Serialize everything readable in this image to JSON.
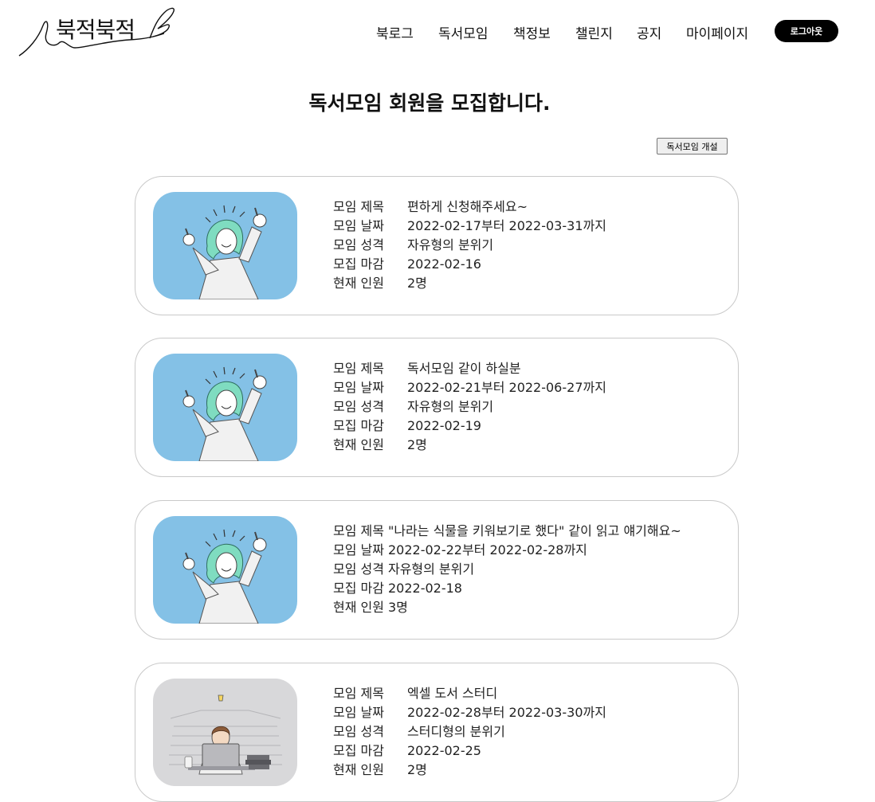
{
  "header": {
    "logo_text": "북적북적",
    "nav": [
      {
        "label": "북로그"
      },
      {
        "label": "독서모임"
      },
      {
        "label": "책정보"
      },
      {
        "label": "챌린지"
      },
      {
        "label": "공지"
      },
      {
        "label": "마이페이지"
      }
    ],
    "logout_label": "로그아웃"
  },
  "main": {
    "title": "독서모임 회원을 모집합니다.",
    "create_button_label": "독서모임 개설"
  },
  "field_labels": {
    "title": "모임 제목",
    "date": "모임 날짜",
    "type": "모임 성격",
    "deadline": "모집 마감",
    "members": "현재 인원"
  },
  "meetings": [
    {
      "title": "편하게 신청해주세요~",
      "date": "2022-02-17부터 2022-03-31까지",
      "type": "자유형의 분위기",
      "deadline": "2022-02-16",
      "members": "2명",
      "image": "thumbs-up-person"
    },
    {
      "title": "독서모임 같이 하실분",
      "date": "2022-02-21부터 2022-06-27까지",
      "type": "자유형의 분위기",
      "deadline": "2022-02-19",
      "members": "2명",
      "image": "thumbs-up-person"
    },
    {
      "title": "\"나라는 식물을 키워보기로 했다\" 같이 읽고 얘기해요~",
      "date": "2022-02-22부터 2022-02-28까지",
      "type": "자유형의 분위기",
      "deadline": "2022-02-18",
      "members": "3명",
      "image": "thumbs-up-person"
    },
    {
      "title": "엑셀 도서 스터디",
      "date": "2022-02-28부터 2022-03-30까지",
      "type": "스터디형의 분위기",
      "deadline": "2022-02-25",
      "members": "2명",
      "image": "study-person-laptop"
    }
  ],
  "colors": {
    "thumb_blue": "#84c1e6",
    "thumb_gray": "#d8d8da",
    "hair_mint": "#7fdcc0",
    "button_black": "#000000"
  }
}
